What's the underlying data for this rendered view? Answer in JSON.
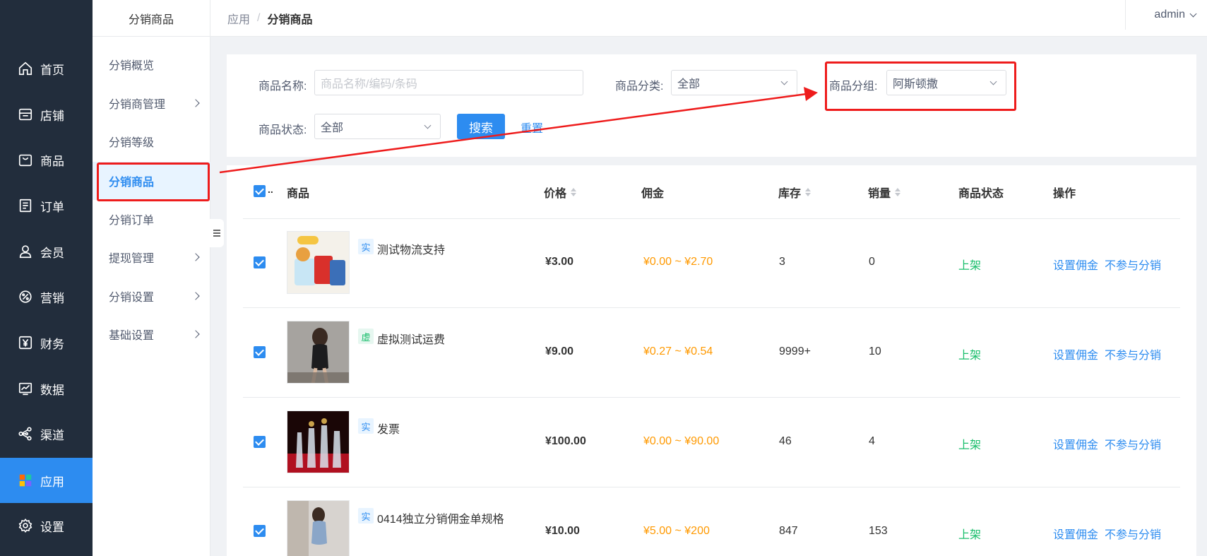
{
  "nav": {
    "items": [
      {
        "label": "首页",
        "icon": "home-icon"
      },
      {
        "label": "店铺",
        "icon": "store-icon"
      },
      {
        "label": "商品",
        "icon": "bag-icon"
      },
      {
        "label": "订单",
        "icon": "order-icon"
      },
      {
        "label": "会员",
        "icon": "user-icon"
      },
      {
        "label": "营销",
        "icon": "marketing-icon"
      },
      {
        "label": "财务",
        "icon": "yen-icon"
      },
      {
        "label": "数据",
        "icon": "chart-icon"
      },
      {
        "label": "渠道",
        "icon": "share-icon"
      },
      {
        "label": "应用",
        "icon": "apps-icon",
        "active": true
      },
      {
        "label": "设置",
        "icon": "gear-icon"
      }
    ],
    "active_color": "#2d8cf0",
    "bg_color": "#222d3c"
  },
  "sub_sidebar": {
    "title": "分销商品",
    "items": [
      {
        "label": "分销概览",
        "has_arrow": false
      },
      {
        "label": "分销商管理",
        "has_arrow": true
      },
      {
        "label": "分销等级",
        "has_arrow": false
      },
      {
        "label": "分销商品",
        "has_arrow": false,
        "active": true
      },
      {
        "label": "分销订单",
        "has_arrow": false
      },
      {
        "label": "提现管理",
        "has_arrow": true
      },
      {
        "label": "分销设置",
        "has_arrow": true
      },
      {
        "label": "基础设置",
        "has_arrow": true
      }
    ]
  },
  "topbar": {
    "breadcrumb": [
      "应用",
      "分销商品"
    ],
    "separator": "/",
    "user": "admin"
  },
  "filter": {
    "name_label": "商品名称:",
    "name_placeholder": "商品名称/编码/条码",
    "category_label": "商品分类:",
    "category_value": "全部",
    "group_label": "商品分组:",
    "group_value": "阿斯顿撒",
    "status_label": "商品状态:",
    "status_value": "全部",
    "search_label": "搜索",
    "reset_label": "重置"
  },
  "table": {
    "headers": {
      "product": "商品",
      "price": "价格",
      "commission": "佣金",
      "stock": "库存",
      "sales": "销量",
      "status": "商品状态",
      "actions": "操作",
      "select_overflow": ".."
    },
    "rows": [
      {
        "tag": "实",
        "tag_type": "real",
        "name": "测试物流支持",
        "price": "¥3.00",
        "commission": "¥0.00 ~ ¥2.70",
        "stock": "3",
        "sales": "0",
        "status": "上架",
        "action1": "设置佣金",
        "action2": "不参与分销",
        "image": "snack-packages"
      },
      {
        "tag": "虚",
        "tag_type": "virtual",
        "name": "虚拟测试运费",
        "price": "¥9.00",
        "commission": "¥0.27 ~ ¥0.54",
        "stock": "9999+",
        "sales": "10",
        "status": "上架",
        "action1": "设置佣金",
        "action2": "不参与分销",
        "image": "fashion-magazine"
      },
      {
        "tag": "实",
        "tag_type": "real",
        "name": "发票",
        "price": "¥100.00",
        "commission": "¥0.00 ~ ¥90.00",
        "stock": "46",
        "sales": "4",
        "status": "上架",
        "action1": "设置佣金",
        "action2": "不参与分销",
        "image": "liquor-bottles"
      },
      {
        "tag": "实",
        "tag_type": "real",
        "name": "0414独立分销佣金单规格",
        "price": "¥10.00",
        "commission": "¥5.00 ~ ¥200",
        "stock": "847",
        "sales": "153",
        "status": "上架",
        "action1": "设置佣金",
        "action2": "不参与分销",
        "image": "model-photo"
      }
    ]
  },
  "annotations": {
    "color": "#ee1c1c"
  }
}
